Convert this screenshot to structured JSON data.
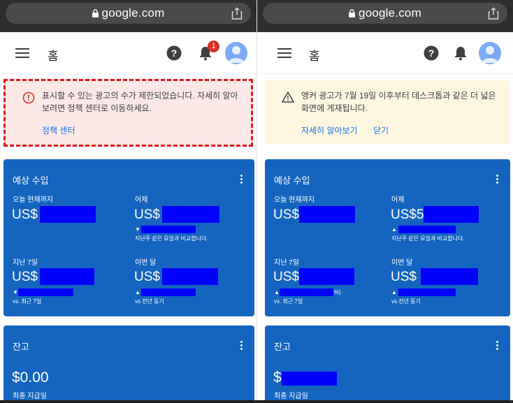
{
  "left": {
    "url": "google.com",
    "app_title": "홈",
    "notification_count": "1",
    "alert": {
      "text": "표시할 수 있는 광고의 수가 제한되었습니다. 자세히 알아보려면 정책 센터로 이동하세요.",
      "link": "정책 센터"
    },
    "earnings": {
      "title": "예상 수입",
      "today_label": "오늘 현재까지",
      "today_value": "US$",
      "yesterday_label": "어제",
      "yesterday_value": "US$",
      "yesterday_compare": "지난주 같은 요일과 비교합니다.",
      "last7_label": "지난 7일",
      "last7_value": "US$",
      "last7_compare": "vs. 최근 7일",
      "month_label": "이번 달",
      "month_value": "US$",
      "month_compare": "vs 전년 동기"
    },
    "balance": {
      "title": "잔고",
      "value": "$0.00",
      "sub": "최종 지급일"
    }
  },
  "right": {
    "url": "google.com",
    "app_title": "홈",
    "alert": {
      "text": "앵커 광고가 7월 19일 이후부터 데스크톱과 같은 더 넓은 화면에 게재됩니다.",
      "link_learn": "자세히 알아보기",
      "link_close": "닫기"
    },
    "earnings": {
      "title": "예상 수입",
      "today_label": "오늘 현재까지",
      "today_value": "US$",
      "yesterday_label": "어제",
      "yesterday_value": "US$5",
      "yesterday_compare": "지난주 같은 요일과 비교합니다.",
      "last7_label": "지난 7일",
      "last7_value": "US$",
      "last7_compare": "vs. 최근 7일",
      "last7_pct": "%)",
      "month_label": "이번 달",
      "month_value": "US$",
      "month_compare": "vs 전년 동기"
    },
    "balance": {
      "title": "잔고",
      "value": "$",
      "sub": "최종 지급일"
    }
  },
  "colors": {
    "card_blue": "#1565c0",
    "redaction_blue": "#0000ff",
    "alert_error_bg": "#fce8e6",
    "alert_warning_bg": "#fef7e0",
    "highlight_dash": "#e0191c",
    "link": "#1a73e8"
  }
}
